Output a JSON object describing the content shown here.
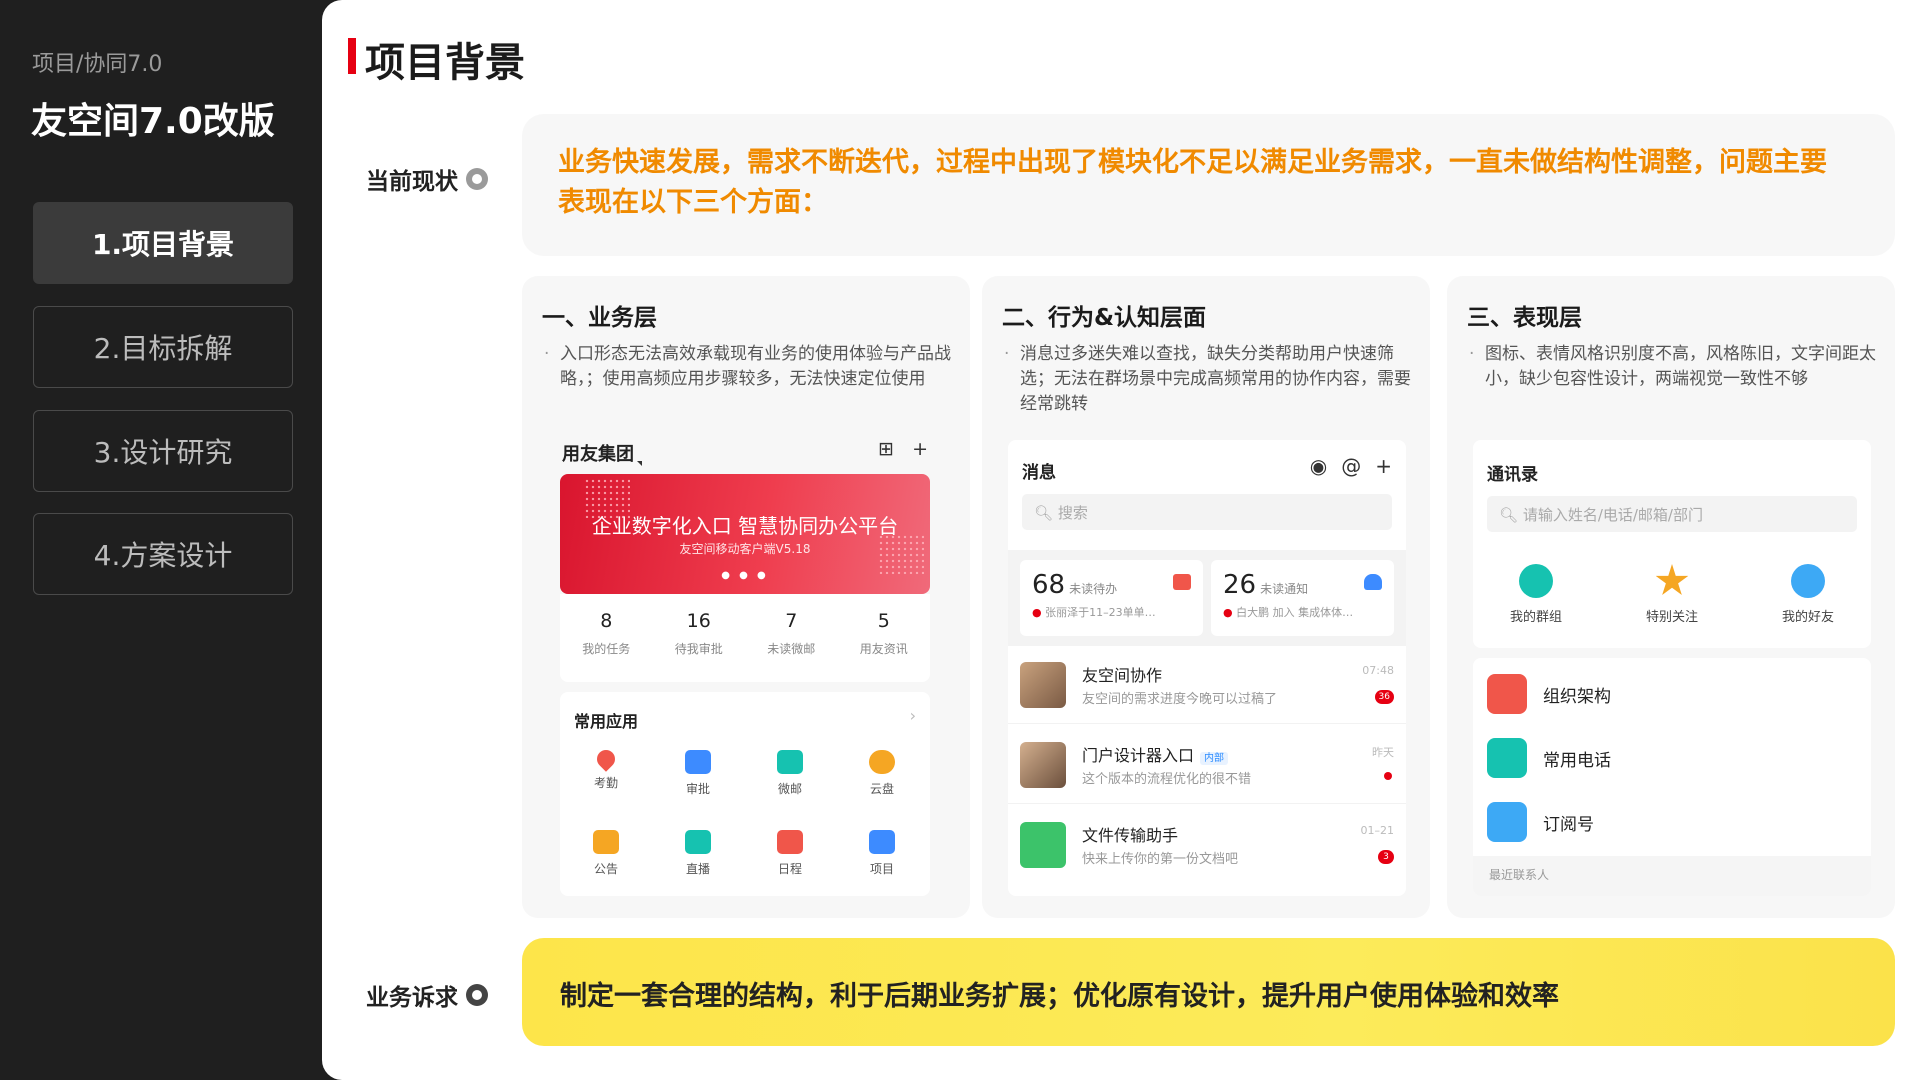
{
  "sidebar": {
    "breadcrumb": "项目/协同7.0",
    "project_title": "友空间7.0改版",
    "nav": [
      {
        "label": "1.项目背景"
      },
      {
        "label": "2.目标拆解"
      },
      {
        "label": "3.设计研究"
      },
      {
        "label": "4.方案设计"
      }
    ]
  },
  "main": {
    "page_title": "项目背景",
    "current_label": "当前现状",
    "current_text": "业务快速发展，需求不断迭代，过程中出现了模块化不足以满足业务需求，一直未做结构性调整，问题主要表现在以下三个方面：",
    "columns": [
      {
        "title": "一、业务层",
        "desc": "入口形态无法高效承载现有业务的使用体验与产品战略，；使用高频应用步骤较多，无法快速定位使用"
      },
      {
        "title": "二、行为&认知层面",
        "desc": "消息过多迷失难以查找，缺失分类帮助用户快速筛选；无法在群场景中完成高频常用的协作内容，需要经常跳转"
      },
      {
        "title": "三、表现层",
        "desc": "图标、表情风格识别度不高，风格陈旧，文字间距太小，缺少包容性设计，两端视觉一致性不够"
      }
    ],
    "ask_label": "业务诉求",
    "ask_text": "制定一套合理的结构，利于后期业务扩展；优化原有设计，提升用户使用体验和效率"
  },
  "mock1": {
    "org": "用友集团",
    "banner_title": "企业数字化入口 智慧协同办公平台",
    "banner_sub": "友空间移动客户端V5.18",
    "banner_dots": "● ● ●",
    "stats": [
      {
        "num": "8",
        "label": "我的任务"
      },
      {
        "num": "16",
        "label": "待我审批"
      },
      {
        "num": "7",
        "label": "未读微邮"
      },
      {
        "num": "5",
        "label": "用友资讯"
      }
    ],
    "apps_title": "常用应用",
    "apps": [
      {
        "label": "考勤",
        "color": "#f0564a"
      },
      {
        "label": "审批",
        "color": "#3d8bff"
      },
      {
        "label": "微邮",
        "color": "#16c2b0"
      },
      {
        "label": "云盘",
        "color": "#f5a623"
      },
      {
        "label": "公告",
        "color": "#f5a623"
      },
      {
        "label": "直播",
        "color": "#16c2b0"
      },
      {
        "label": "日程",
        "color": "#f0564a"
      },
      {
        "label": "项目",
        "color": "#3d8bff"
      }
    ]
  },
  "mock2": {
    "title": "消息",
    "icons": [
      "◉",
      "@",
      "+"
    ],
    "search_placeholder": "搜索",
    "tiles": [
      {
        "num": "68",
        "unit": "未读待办",
        "sub": "张丽泽于11–23单单…",
        "icon_color": "#f0564a"
      },
      {
        "num": "26",
        "unit": "未读通知",
        "sub": "白大鹏 加入 集成体体…",
        "icon_color": "#3d8bff"
      }
    ],
    "chats": [
      {
        "name": "友空间协作",
        "msg": "友空间的需求进度今晚可以过稿了",
        "time": "07:48",
        "badge": "36",
        "tag": ""
      },
      {
        "name": "门户设计器入口",
        "msg": "这个版本的流程优化的很不错",
        "time": "昨天",
        "badge": "",
        "tag": "内部"
      },
      {
        "name": "文件传输助手",
        "msg": "快来上传你的第一份文档吧",
        "time": "01–21",
        "badge": "3",
        "tag": ""
      }
    ]
  },
  "mock3": {
    "title": "通讯录",
    "search_placeholder": "请输入姓名/电话/邮箱/部门",
    "quick": [
      {
        "label": "我的群组",
        "color": "#16c2b0"
      },
      {
        "label": "特别关注",
        "color": "#f5a623"
      },
      {
        "label": "我的好友",
        "color": "#3da9f5"
      }
    ],
    "items": [
      {
        "label": "组织架构",
        "color": "#f0564a"
      },
      {
        "label": "常用电话",
        "color": "#16c2b0"
      },
      {
        "label": "订阅号",
        "color": "#3da9f5"
      }
    ],
    "recent": "最近联系人"
  }
}
